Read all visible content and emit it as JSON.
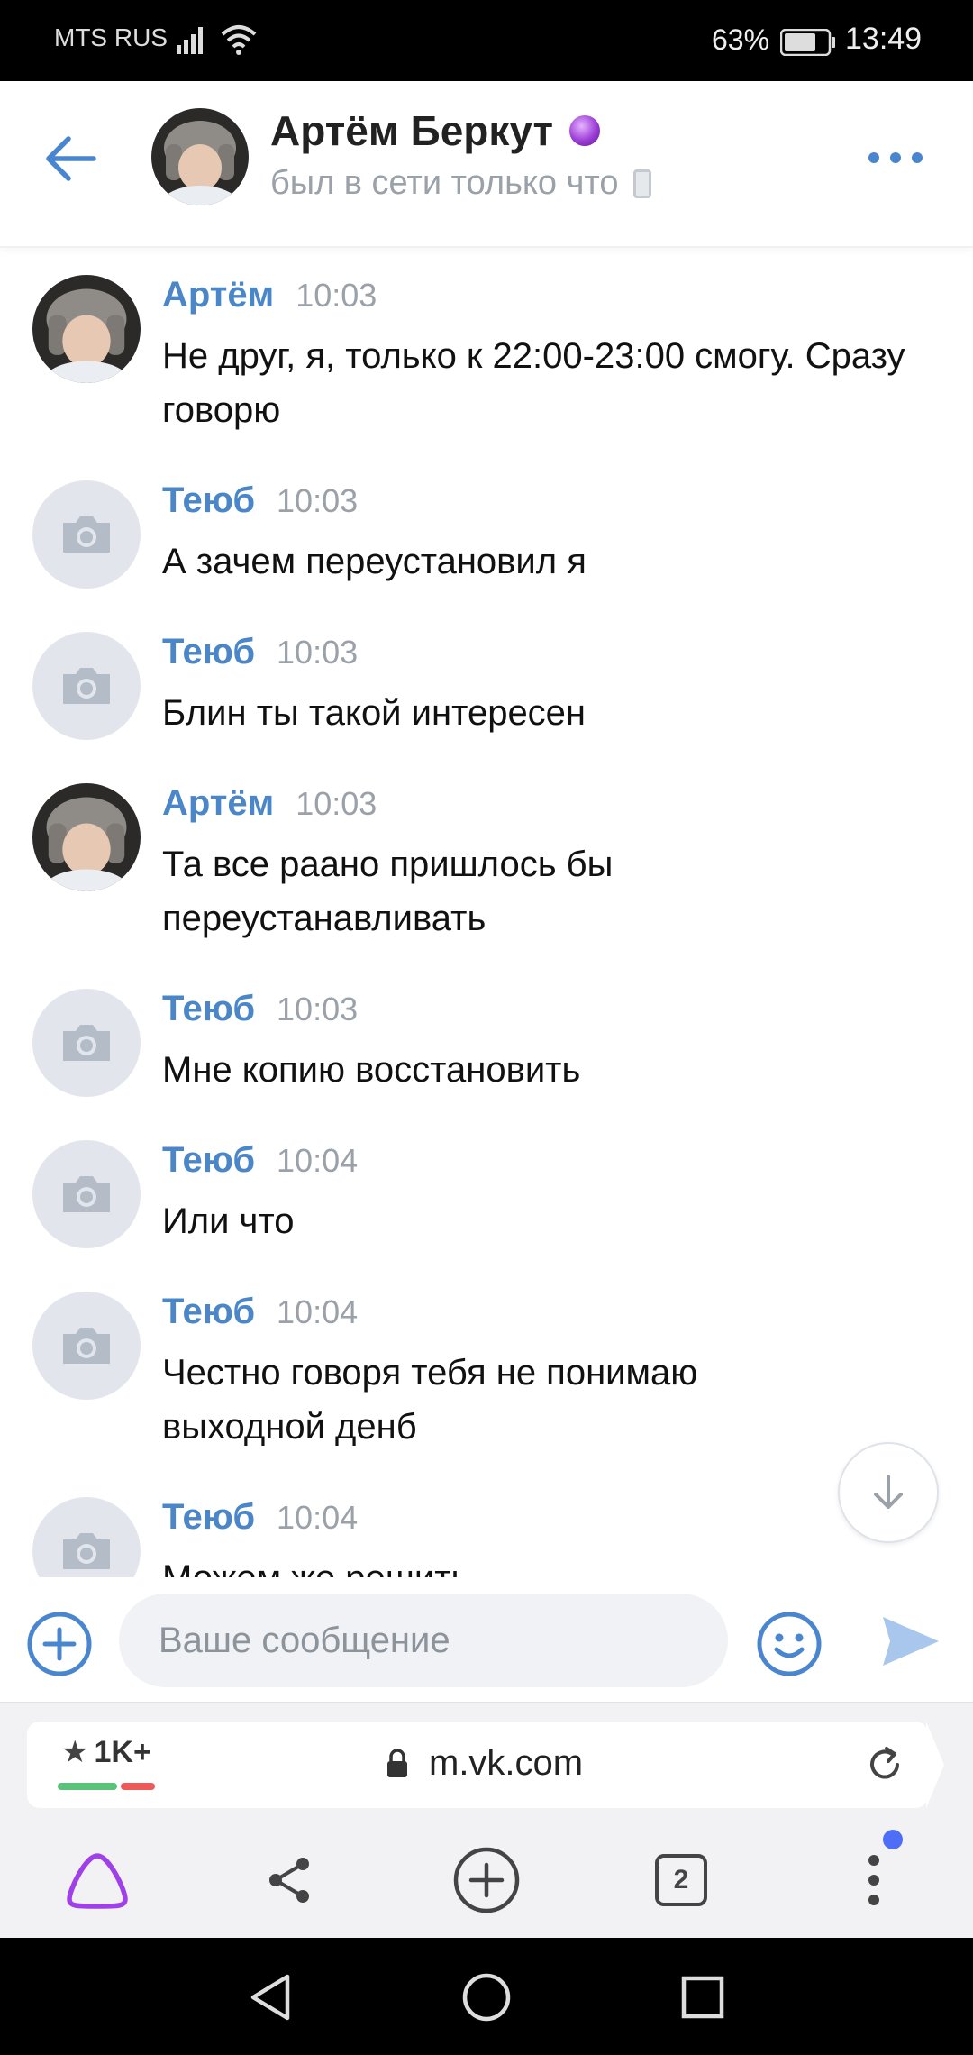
{
  "status_bar": {
    "carrier": "MTS RUS",
    "battery": "63%",
    "time": "13:49"
  },
  "header": {
    "name": "Артём Беркут",
    "status": "был в сети только что"
  },
  "messages": [
    {
      "author": "Артём",
      "time": "10:03",
      "text": "Не друг, я, только к 22:00-23:00 смогу. Сразу говорю",
      "avatar": "photo"
    },
    {
      "author": "Теюб",
      "time": "10:03",
      "text": "А зачем переустановил я",
      "avatar": "camera-placeholder"
    },
    {
      "author": "Теюб",
      "time": "10:03",
      "text": "Блин ты такой интересен",
      "avatar": "camera-placeholder"
    },
    {
      "author": "Артём",
      "time": "10:03",
      "text": "Та все раано пришлось бы переустанавливать",
      "avatar": "photo"
    },
    {
      "author": "Теюб",
      "time": "10:03",
      "text": "Мне копию восстановить",
      "avatar": "camera-placeholder"
    },
    {
      "author": "Теюб",
      "time": "10:04",
      "text": "Или что",
      "avatar": "camera-placeholder"
    },
    {
      "author": "Теюб",
      "time": "10:04",
      "text": "Честно говоря тебя не понимаю выходной денб",
      "avatar": "camera-placeholder"
    },
    {
      "author": "Теюб",
      "time": "10:04",
      "text": "Можем же решить",
      "avatar": "camera-placeholder"
    }
  ],
  "composer": {
    "placeholder": "Ваше сообщение"
  },
  "browser": {
    "rating": "1K+",
    "url": "m.vk.com",
    "tabs_count": "2"
  },
  "colors": {
    "accent": "#4a86c8",
    "author": "#4a86c8",
    "meta": "#9aa1a9",
    "alice": "#a040e8",
    "send": "#a9c6ec"
  }
}
